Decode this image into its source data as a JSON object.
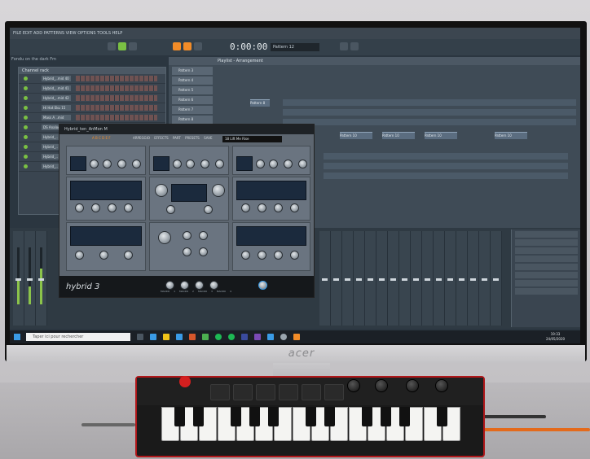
{
  "scene": {
    "monitor_brand": "acer"
  },
  "fl": {
    "menu": "FILE  EDIT  ADD  PATTERNS  VIEW  OPTIONS  TOOLS  HELP",
    "time_display": "0:00:00",
    "pattern_selector": "Pattern 12",
    "hint_text": "Fondu on the dark Fm",
    "channel_rack_title": "Channel rack",
    "playlist_title": "Playlist - Arrangement",
    "channels": [
      "Hybrid_..mid 40",
      "Hybrid_..mid 41",
      "Hybrid_..mid 42",
      "Hi Hat Eku 15",
      "Mass A ..mid",
      "DS Analog Bass",
      "Hybrid_..",
      "Hybrid_..",
      "Hybrid_..",
      "Hybrid_.."
    ],
    "patterns": [
      "Pattern 3",
      "Pattern 4",
      "Pattern 5",
      "Pattern 6",
      "Pattern 7",
      "Pattern 8"
    ],
    "clip_labels": [
      "Pattern 8",
      "Pattern 10",
      "Pattern 10",
      "Pattern 10",
      "Pattern 10"
    ]
  },
  "plugin": {
    "window_title": "Hybrid_ten_AnMon M",
    "tabs": [
      "A",
      "B",
      "C",
      "D",
      "E",
      "F"
    ],
    "menu_items": [
      "ARPEGGIO",
      "EFFECTS",
      "PART PRESETS",
      "SAVE"
    ],
    "preset": "18 Lift Me Rise",
    "logo": "hybrid 3",
    "bottom_labels": [
      "MACRO 1",
      "MACRO 2",
      "MACRO 3",
      "MACRO 4"
    ]
  },
  "taskbar": {
    "search_placeholder": "Taper ici pour rechercher",
    "time": "19:33",
    "date": "24/05/2020"
  },
  "colors": {
    "fl_bg": "#2b3640",
    "accent_orange": "#f28c28",
    "step_active": "#6f5252",
    "meter_green": "#8bc34a",
    "keyboard_trim": "#b0171a"
  }
}
